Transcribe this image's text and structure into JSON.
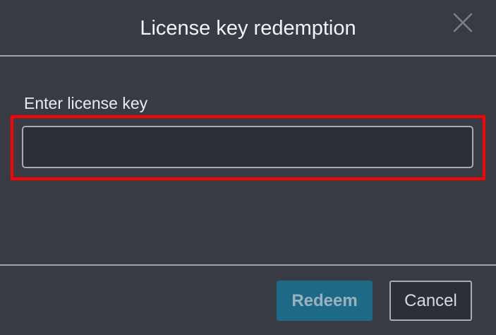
{
  "dialog": {
    "title": "License key redemption",
    "close_icon": "close-icon"
  },
  "form": {
    "label": "Enter license key",
    "input_value": "",
    "input_placeholder": ""
  },
  "footer": {
    "redeem_label": "Redeem",
    "cancel_label": "Cancel"
  },
  "colors": {
    "background": "#383b44",
    "highlight": "#ff0000",
    "redeem_button": "#1d6a88",
    "input_background": "#2d2f36"
  }
}
